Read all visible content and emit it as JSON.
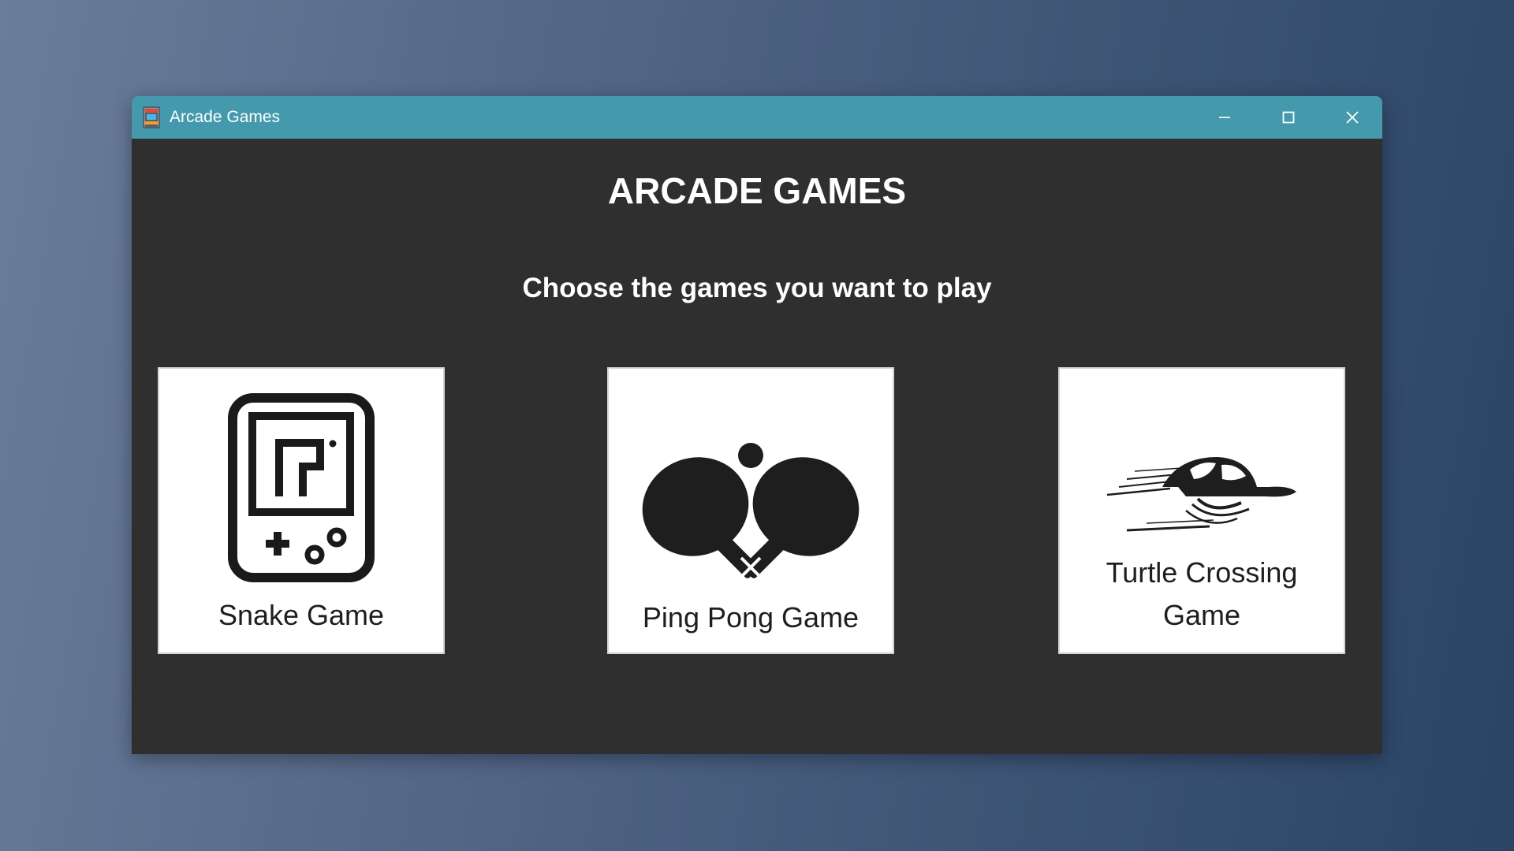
{
  "window": {
    "title": "Arcade Games",
    "titlebar_color": "#449aac",
    "background_color": "#2f2f2f",
    "controls": [
      "minimize-icon",
      "maximize-icon",
      "close-icon"
    ]
  },
  "main": {
    "heading": "ARCADE GAMES",
    "subheading": "Choose the games you want to play"
  },
  "games": [
    {
      "label": "Snake Game",
      "icon": "handheld-console-icon"
    },
    {
      "label": "Ping Pong Game",
      "icon": "ping-pong-paddles-icon"
    },
    {
      "label": "Turtle Crossing Game",
      "icon": "speeding-turtle-icon"
    }
  ]
}
